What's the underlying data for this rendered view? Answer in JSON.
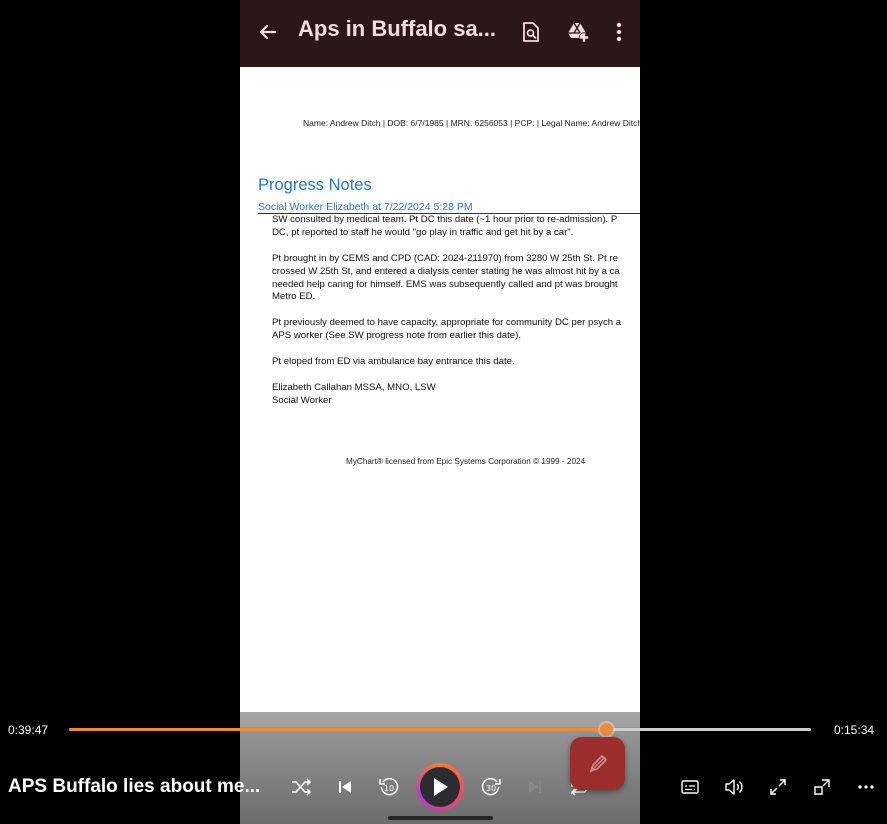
{
  "phone": {
    "app_title": "Aps in Buffalo sa...",
    "icons": [
      "back-arrow-icon",
      "find-in-page-icon",
      "drive-add-icon",
      "more-vertical-icon"
    ]
  },
  "document": {
    "header": "Name: Andrew Ditch | DOB: 6/7/1985 | MRN: 6256053 | PCP: | Legal Name: Andrew Ditch",
    "section_title": "Progress Notes",
    "note_author": "Social Worker Elizabeth at 7/22/2024  5:28 PM",
    "lines": [
      "SW consulted by medical team. Pt DC this date (~1 hour prior to re-admission). P",
      "DC, pt reported to staff he would \"go play in traffic and get hit by a car\".",
      "",
      "Pt brought in by CEMS and CPD (CAD: 2024-211970) from 3280 W 25th St. Pt re",
      "crossed W 25th St, and entered a dialysis center stating he was almost hit by a ca",
      "needed help caring for himself. EMS was subsequently called and pt was brought",
      "Metro ED.",
      "",
      "Pt previously deemed to have capacity, appropriate for community DC per psych a",
      "APS worker (See SW progress note from earlier this date).",
      "",
      "Pt eloped from ED via ambulance bay entrance this date.",
      "",
      "Elizabeth Callahan MSSA, MNO, LSW",
      "Social Worker"
    ],
    "footer": "MyChart® licensed from Epic Systems Corporation © 1999 - 2024"
  },
  "player": {
    "elapsed": "0:39:47",
    "remaining": "0:15:34",
    "progress_fraction": 0.7237,
    "media_title": "APS Buffalo lies about me...",
    "accent_color": "#f28a3c"
  }
}
